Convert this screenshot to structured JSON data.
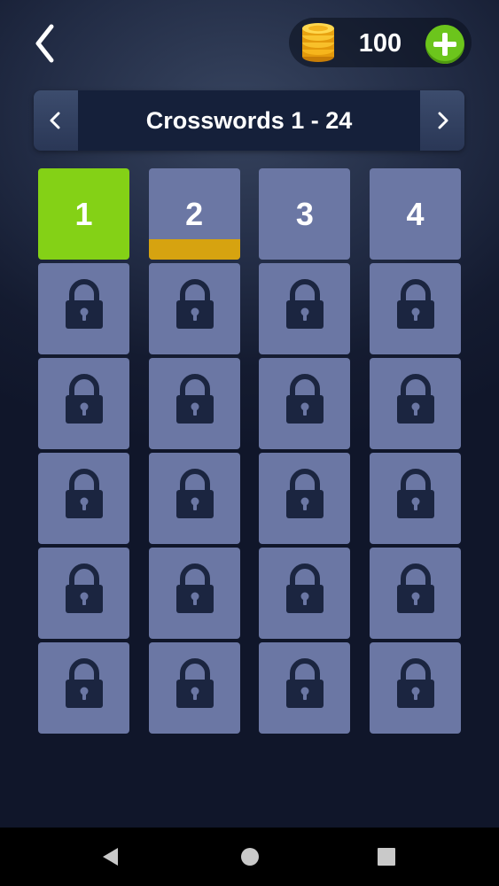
{
  "header": {
    "back_icon": "chevron-left-icon",
    "coins": "100",
    "coins_icon": "coin-stack-icon",
    "add_coins_icon": "plus-icon"
  },
  "pager": {
    "title": "Crosswords 1 - 24",
    "prev_icon": "chevron-left-icon",
    "next_icon": "chevron-right-icon"
  },
  "levels": [
    {
      "number": "1",
      "state": "solved"
    },
    {
      "number": "2",
      "state": "in-progress",
      "progress": 0.22
    },
    {
      "number": "3",
      "state": "open"
    },
    {
      "number": "4",
      "state": "open"
    },
    {
      "state": "locked"
    },
    {
      "state": "locked"
    },
    {
      "state": "locked"
    },
    {
      "state": "locked"
    },
    {
      "state": "locked"
    },
    {
      "state": "locked"
    },
    {
      "state": "locked"
    },
    {
      "state": "locked"
    },
    {
      "state": "locked"
    },
    {
      "state": "locked"
    },
    {
      "state": "locked"
    },
    {
      "state": "locked"
    },
    {
      "state": "locked"
    },
    {
      "state": "locked"
    },
    {
      "state": "locked"
    },
    {
      "state": "locked"
    },
    {
      "state": "locked"
    },
    {
      "state": "locked"
    },
    {
      "state": "locked"
    },
    {
      "state": "locked"
    }
  ],
  "colors": {
    "solved": "#84d116",
    "tile": "#6b77a4",
    "progress": "#d6a310",
    "lock": "#1b2540",
    "add_button": "#6cc51c"
  },
  "navbar": {
    "back_icon": "triangle-back-icon",
    "home_icon": "circle-home-icon",
    "recents_icon": "square-recents-icon"
  }
}
